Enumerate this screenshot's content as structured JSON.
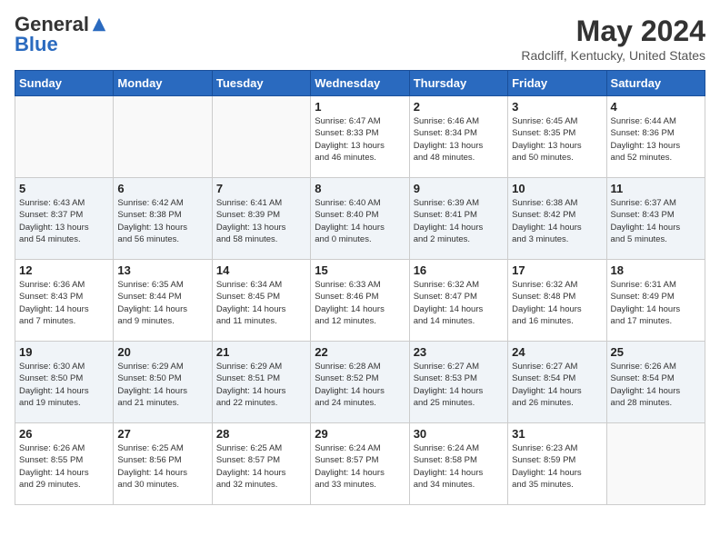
{
  "header": {
    "logo_general": "General",
    "logo_blue": "Blue",
    "month_year": "May 2024",
    "location": "Radcliff, Kentucky, United States"
  },
  "days_of_week": [
    "Sunday",
    "Monday",
    "Tuesday",
    "Wednesday",
    "Thursday",
    "Friday",
    "Saturday"
  ],
  "weeks": [
    [
      {
        "num": "",
        "info": ""
      },
      {
        "num": "",
        "info": ""
      },
      {
        "num": "",
        "info": ""
      },
      {
        "num": "1",
        "info": "Sunrise: 6:47 AM\nSunset: 8:33 PM\nDaylight: 13 hours\nand 46 minutes."
      },
      {
        "num": "2",
        "info": "Sunrise: 6:46 AM\nSunset: 8:34 PM\nDaylight: 13 hours\nand 48 minutes."
      },
      {
        "num": "3",
        "info": "Sunrise: 6:45 AM\nSunset: 8:35 PM\nDaylight: 13 hours\nand 50 minutes."
      },
      {
        "num": "4",
        "info": "Sunrise: 6:44 AM\nSunset: 8:36 PM\nDaylight: 13 hours\nand 52 minutes."
      }
    ],
    [
      {
        "num": "5",
        "info": "Sunrise: 6:43 AM\nSunset: 8:37 PM\nDaylight: 13 hours\nand 54 minutes."
      },
      {
        "num": "6",
        "info": "Sunrise: 6:42 AM\nSunset: 8:38 PM\nDaylight: 13 hours\nand 56 minutes."
      },
      {
        "num": "7",
        "info": "Sunrise: 6:41 AM\nSunset: 8:39 PM\nDaylight: 13 hours\nand 58 minutes."
      },
      {
        "num": "8",
        "info": "Sunrise: 6:40 AM\nSunset: 8:40 PM\nDaylight: 14 hours\nand 0 minutes."
      },
      {
        "num": "9",
        "info": "Sunrise: 6:39 AM\nSunset: 8:41 PM\nDaylight: 14 hours\nand 2 minutes."
      },
      {
        "num": "10",
        "info": "Sunrise: 6:38 AM\nSunset: 8:42 PM\nDaylight: 14 hours\nand 3 minutes."
      },
      {
        "num": "11",
        "info": "Sunrise: 6:37 AM\nSunset: 8:43 PM\nDaylight: 14 hours\nand 5 minutes."
      }
    ],
    [
      {
        "num": "12",
        "info": "Sunrise: 6:36 AM\nSunset: 8:43 PM\nDaylight: 14 hours\nand 7 minutes."
      },
      {
        "num": "13",
        "info": "Sunrise: 6:35 AM\nSunset: 8:44 PM\nDaylight: 14 hours\nand 9 minutes."
      },
      {
        "num": "14",
        "info": "Sunrise: 6:34 AM\nSunset: 8:45 PM\nDaylight: 14 hours\nand 11 minutes."
      },
      {
        "num": "15",
        "info": "Sunrise: 6:33 AM\nSunset: 8:46 PM\nDaylight: 14 hours\nand 12 minutes."
      },
      {
        "num": "16",
        "info": "Sunrise: 6:32 AM\nSunset: 8:47 PM\nDaylight: 14 hours\nand 14 minutes."
      },
      {
        "num": "17",
        "info": "Sunrise: 6:32 AM\nSunset: 8:48 PM\nDaylight: 14 hours\nand 16 minutes."
      },
      {
        "num": "18",
        "info": "Sunrise: 6:31 AM\nSunset: 8:49 PM\nDaylight: 14 hours\nand 17 minutes."
      }
    ],
    [
      {
        "num": "19",
        "info": "Sunrise: 6:30 AM\nSunset: 8:50 PM\nDaylight: 14 hours\nand 19 minutes."
      },
      {
        "num": "20",
        "info": "Sunrise: 6:29 AM\nSunset: 8:50 PM\nDaylight: 14 hours\nand 21 minutes."
      },
      {
        "num": "21",
        "info": "Sunrise: 6:29 AM\nSunset: 8:51 PM\nDaylight: 14 hours\nand 22 minutes."
      },
      {
        "num": "22",
        "info": "Sunrise: 6:28 AM\nSunset: 8:52 PM\nDaylight: 14 hours\nand 24 minutes."
      },
      {
        "num": "23",
        "info": "Sunrise: 6:27 AM\nSunset: 8:53 PM\nDaylight: 14 hours\nand 25 minutes."
      },
      {
        "num": "24",
        "info": "Sunrise: 6:27 AM\nSunset: 8:54 PM\nDaylight: 14 hours\nand 26 minutes."
      },
      {
        "num": "25",
        "info": "Sunrise: 6:26 AM\nSunset: 8:54 PM\nDaylight: 14 hours\nand 28 minutes."
      }
    ],
    [
      {
        "num": "26",
        "info": "Sunrise: 6:26 AM\nSunset: 8:55 PM\nDaylight: 14 hours\nand 29 minutes."
      },
      {
        "num": "27",
        "info": "Sunrise: 6:25 AM\nSunset: 8:56 PM\nDaylight: 14 hours\nand 30 minutes."
      },
      {
        "num": "28",
        "info": "Sunrise: 6:25 AM\nSunset: 8:57 PM\nDaylight: 14 hours\nand 32 minutes."
      },
      {
        "num": "29",
        "info": "Sunrise: 6:24 AM\nSunset: 8:57 PM\nDaylight: 14 hours\nand 33 minutes."
      },
      {
        "num": "30",
        "info": "Sunrise: 6:24 AM\nSunset: 8:58 PM\nDaylight: 14 hours\nand 34 minutes."
      },
      {
        "num": "31",
        "info": "Sunrise: 6:23 AM\nSunset: 8:59 PM\nDaylight: 14 hours\nand 35 minutes."
      },
      {
        "num": "",
        "info": ""
      }
    ]
  ]
}
